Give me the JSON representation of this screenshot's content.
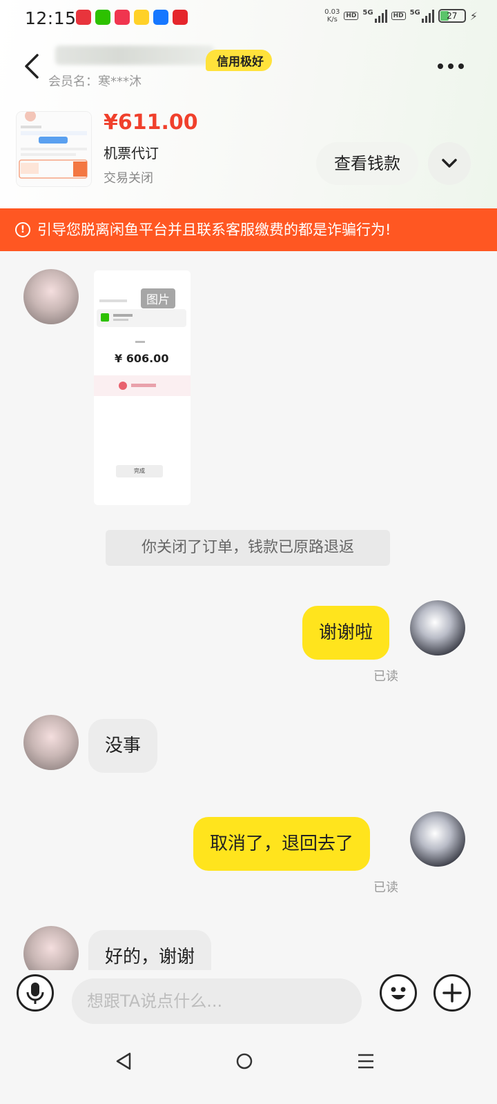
{
  "status_bar": {
    "time": "12:15",
    "net_speed_value": "0.03",
    "net_speed_unit": "K/s",
    "hd_label": "HD",
    "network_type": "5G",
    "battery_level": "27"
  },
  "header": {
    "credit_badge": "信用极好",
    "member_label": "会员名：寒***沐"
  },
  "product": {
    "price": "¥611.00",
    "title": "机票代订",
    "status": "交易关闭",
    "view_payment_label": "查看钱款"
  },
  "warning": {
    "text": "引导您脱离闲鱼平台并且联系客服缴费的都是诈骗行为!"
  },
  "chat": {
    "image_label": "图片",
    "image_amount": "¥ 606.00",
    "image_done_label": "完成",
    "system_message": "你关闭了订单，钱款已原路退返",
    "messages": [
      {
        "sender": "me",
        "text": "谢谢啦",
        "status": "已读"
      },
      {
        "sender": "peer",
        "text": "没事"
      },
      {
        "sender": "me",
        "text": "取消了，退回去了",
        "status": "已读"
      },
      {
        "sender": "peer",
        "text": "好的，谢谢"
      }
    ]
  },
  "input": {
    "placeholder": "想跟TA说点什么..."
  },
  "colors": {
    "accent_yellow": "#ffe41d",
    "price_red": "#f0402c",
    "warning_orange": "#ff5722"
  }
}
